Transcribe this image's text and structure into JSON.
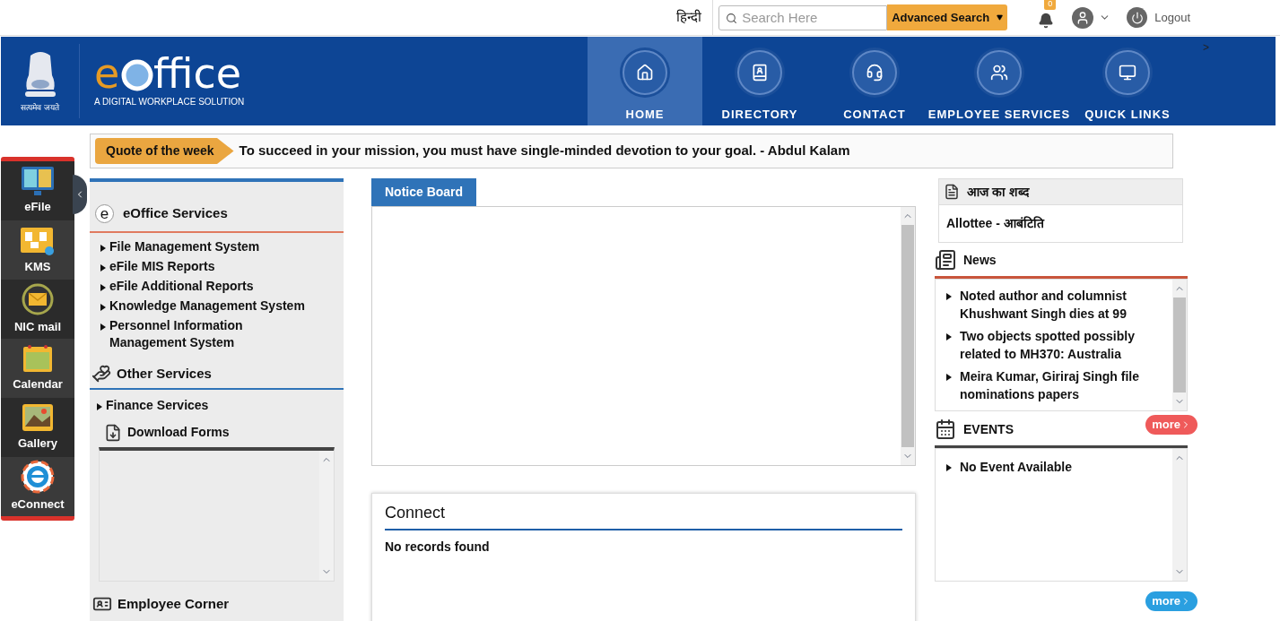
{
  "top_bar": {
    "language": "हिन्दी",
    "search": {
      "placeholder": "Search Here"
    },
    "advanced_search": "Advanced Search",
    "notification_count": "0",
    "logout": "Logout"
  },
  "banner": {
    "logo_first": "e",
    "logo_rest": "ffice",
    "tagline": "A DIGITAL WORKPLACE SOLUTION",
    "emblem_motto": "सत्यमेव जयते",
    "corner_mark": ">",
    "nav": [
      {
        "label": "HOME",
        "kind": "home",
        "selected": true
      },
      {
        "label": "DIRECTORY",
        "kind": "directory",
        "selected": false
      },
      {
        "label": "CONTACT",
        "kind": "contact",
        "selected": false
      },
      {
        "label": "EMPLOYEE SERVICES",
        "kind": "people",
        "selected": false
      },
      {
        "label": "QUICK LINKS",
        "kind": "computer",
        "selected": false
      }
    ]
  },
  "quote": {
    "label": "Quote of the week",
    "text": "To succeed in your mission, you must have single-minded devotion to your goal. - Abdul Kalam"
  },
  "dock": [
    {
      "label": "eFile",
      "kind": "efile"
    },
    {
      "label": "KMS",
      "kind": "kms"
    },
    {
      "label": "NIC mail",
      "kind": "mail"
    },
    {
      "label": "Calendar",
      "kind": "calendar"
    },
    {
      "label": "Gallery",
      "kind": "gallery"
    },
    {
      "label": "eConnect",
      "kind": "econnect"
    }
  ],
  "left": {
    "eoffice_icon_letter": "e",
    "eoffice_title": "eOffice Services",
    "eoffice_items": [
      "File Management System",
      "eFile MIS Reports",
      "eFile Additional Reports",
      "Knowledge Management System",
      "Personnel Information Management System"
    ],
    "other_title": "Other Services",
    "other_items": [
      "Finance Services"
    ],
    "download_forms": "Download Forms",
    "employee_corner": "Employee Corner"
  },
  "notice_board": {
    "title": "Notice Board"
  },
  "connect": {
    "title": "Connect",
    "empty": "No records found"
  },
  "word_of_day": {
    "title": "आज का शब्द",
    "text": "Allottee - आबंटिति"
  },
  "news": {
    "title": "News",
    "items": [
      "Noted author and columnist Khushwant Singh dies at 99",
      "Two objects spotted possibly related to MH370: Australia",
      "Meira Kumar, Giriraj Singh file nominations papers"
    ]
  },
  "events": {
    "title": "EVENTS",
    "more": "more",
    "items": [
      "No Event Available"
    ]
  },
  "bottom_more": "more"
}
